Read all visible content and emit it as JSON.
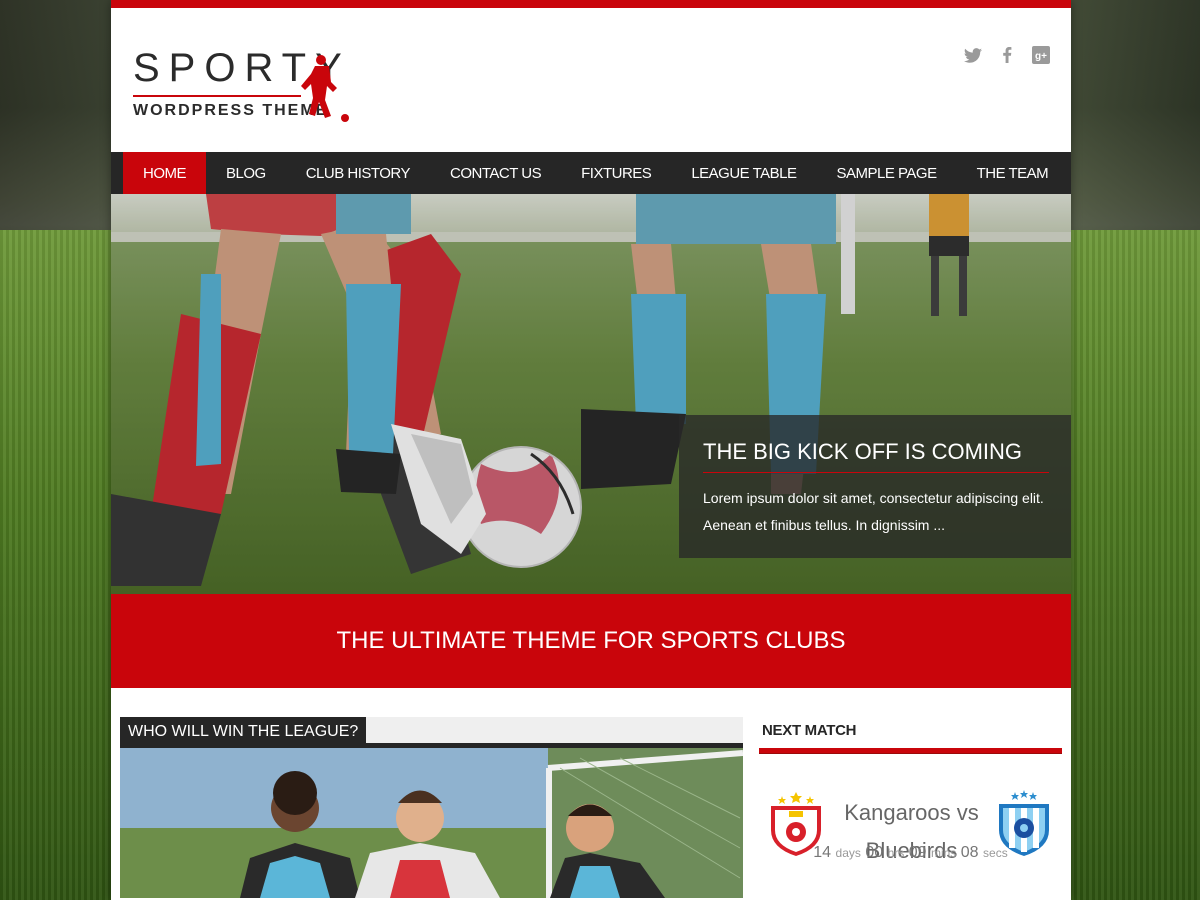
{
  "header": {
    "logo_title": "SPORTY",
    "logo_subtitle": "WORDPRESS THEME",
    "social": [
      {
        "name": "twitter-icon",
        "glyph": "🐦"
      },
      {
        "name": "facebook-icon",
        "glyph": "f"
      },
      {
        "name": "google-plus-icon",
        "glyph": "g+"
      }
    ]
  },
  "nav": {
    "items": [
      {
        "label": "Home",
        "active": true
      },
      {
        "label": "Blog"
      },
      {
        "label": "Club History"
      },
      {
        "label": "Contact Us"
      },
      {
        "label": "Fixtures"
      },
      {
        "label": "League Table"
      },
      {
        "label": "Sample Page"
      },
      {
        "label": "The Team"
      }
    ]
  },
  "hero": {
    "caption_title": "The Big Kick Off Is Coming",
    "caption_text_1": "Lorem ipsum dolor sit amet, consectetur adipiscing elit.",
    "caption_text_2": "Aenean et finibus tellus. In dignissim ..."
  },
  "banner": {
    "text": "The Ultimate Theme For Sports Clubs"
  },
  "widget_left": {
    "title": "Who Will Win The League?"
  },
  "next_match": {
    "title": "Next Match",
    "home_team": "Kangaroos vs",
    "away_team": "Bluebirds",
    "days": "14",
    "days_label": "days",
    "hrs": "00",
    "hrs_label": "hrs",
    "mins": "09",
    "mins_label": "mins",
    "secs": "08",
    "secs_label": "secs"
  },
  "colors": {
    "accent": "#c9050b",
    "dark": "#262626"
  }
}
